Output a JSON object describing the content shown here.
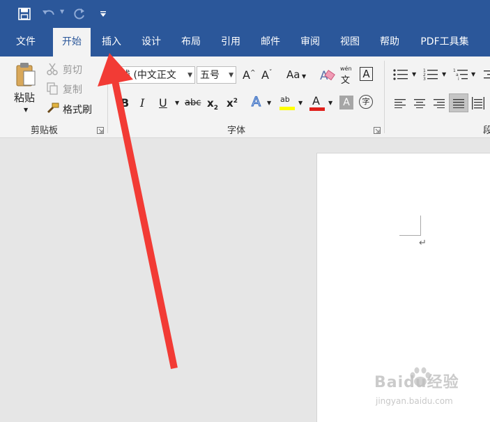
{
  "ribbon_tabs": [
    {
      "label": "文件"
    },
    {
      "label": "开始"
    },
    {
      "label": "插入"
    },
    {
      "label": "设计"
    },
    {
      "label": "布局"
    },
    {
      "label": "引用"
    },
    {
      "label": "邮件"
    },
    {
      "label": "审阅"
    },
    {
      "label": "视图"
    },
    {
      "label": "帮助"
    },
    {
      "label": "PDF工具集"
    }
  ],
  "active_tab": "开始",
  "clipboard": {
    "paste_label": "粘贴",
    "cut_label": "剪切",
    "copy_label": "复制",
    "format_painter_label": "格式刷",
    "group_label": "剪贴板"
  },
  "font": {
    "font_name_value": "线 (中文正文",
    "font_size_value": "五号",
    "case_label": "Aa",
    "pinyin_top": "wén",
    "pinyin_bottom": "文",
    "border_char": "A",
    "bold": "B",
    "italic": "I",
    "underline": "U",
    "strike": "abc",
    "subscript_base": "x",
    "subscript_mark": "2",
    "superscript_base": "x",
    "superscript_mark": "2",
    "effects": "A",
    "highlight": "ab",
    "font_color": "A",
    "shading": "A",
    "enclose": "字",
    "grow": "A",
    "shrink": "A",
    "group_label": "字体"
  },
  "paragraph": {
    "group_label_partial": "段"
  },
  "document": {
    "return_mark": "↵"
  },
  "watermark": {
    "brand": "Baidu经验",
    "url": "jingyan.baidu.com"
  },
  "colors": {
    "title_bar": "#2b579a",
    "ribbon_bg": "#f3f3f3",
    "doc_bg": "#e6e6e6",
    "arrow": "#f23b35",
    "highlight_yellow": "#ffff00",
    "font_red": "#e0201b"
  },
  "icons": [
    "save-icon",
    "undo-icon",
    "redo-icon",
    "customize-qat-icon",
    "paste-icon",
    "cut-icon",
    "copy-icon",
    "format-painter-icon",
    "dialog-launcher-icon",
    "bullets-icon",
    "numbering-icon",
    "multilevel-list-icon",
    "align-left-icon",
    "center-icon",
    "align-right-icon",
    "justify-icon",
    "distributed-icon",
    "eraser-icon"
  ]
}
